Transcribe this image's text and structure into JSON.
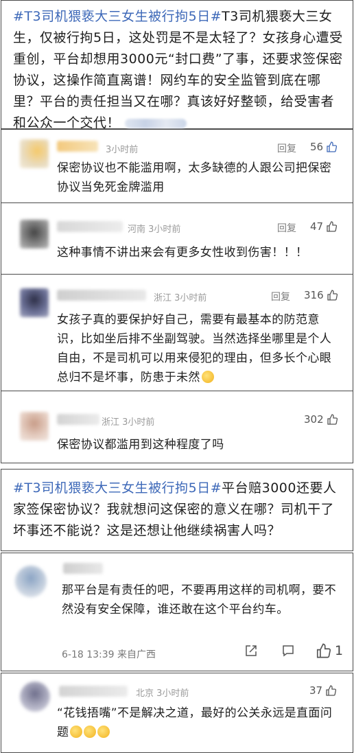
{
  "post1": {
    "hashtag": "#T3司机猥亵大三女生被行拘5日#",
    "text": "T3司机猥亵大三女生，仅被行拘5日，这处罚是不是太轻了？女孩身心遭受重创，平台却想用3000元“封口费”了事，还要求签保密协议，这操作简直离谱！网约车的安全监管到底在哪里？平台的责任担当又在哪？真该好好整顿，给受害者和公众一个交代！"
  },
  "comments": [
    {
      "location": "",
      "time": "3小时前",
      "reply": "回复",
      "likes": "56",
      "text": "保密协议也不能滥用啊，太多缺德的人跟公司把保密协议当免死金牌滥用"
    },
    {
      "location": "河南",
      "time": "3小时前",
      "reply": "回复",
      "likes": "47",
      "text": "这种事情不讲出来会有更多女性收到伤害！！！"
    },
    {
      "location": "浙江",
      "time": "3小时前",
      "reply": "回复",
      "likes": "316",
      "text": "女孩子真的要保护好自己，需要有最基本的防范意识，比如坐后排不坐副驾驶。当然选择坐哪里是个人自由，不是司机可以用来侵犯的理由，但多长个心眼总归不是坏事，防患于未然"
    },
    {
      "location": "浙江",
      "time": "3小时前",
      "reply": "",
      "likes": "302",
      "text": "保密协议都滥用到这种程度了吗"
    }
  ],
  "post2": {
    "hashtag": "#T3司机猥亵大三女生被行拘5日#",
    "text": "平台赔3000还要人家签保密协议？我就想问这保密的意义在哪？司机干了坏事还不能说？这是还想让他继续祸害人吗？"
  },
  "comment5": {
    "text": "那平台是有责任的吧，不要再用这样的司机啊，要不然没有安全保障，谁还敢在这个平台约车。",
    "date": "6-18 13:39",
    "source": "来自广西",
    "like_count": "1"
  },
  "comment6": {
    "location": "北京",
    "time": "3小时前",
    "likes": "37",
    "text": "“花钱捂嘴”不是解决之道，最好的公关永远是直面问题"
  }
}
